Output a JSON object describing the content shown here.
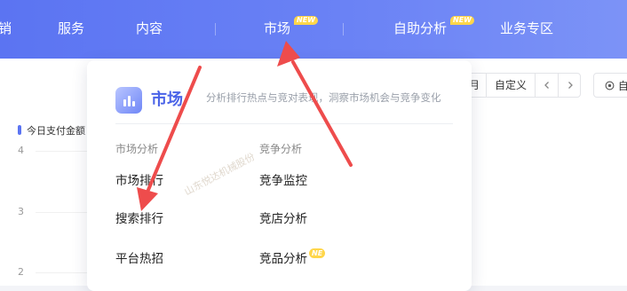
{
  "nav": {
    "items": [
      {
        "label": "销"
      },
      {
        "label": "服务"
      },
      {
        "label": "内容"
      },
      {
        "label": "市场",
        "badge": "NEW"
      },
      {
        "label": "自助分析",
        "badge": "NEW"
      },
      {
        "label": "业务专区"
      }
    ]
  },
  "dropdown": {
    "title": "市场",
    "description": "分析排行热点与竞对表现，洞察市场机会与竞争变化",
    "logo_icon": "chart-bars-icon",
    "groups": [
      {
        "heading": "市场分析",
        "links": [
          "市场排行",
          "搜索排行",
          "平台热招"
        ]
      },
      {
        "heading": "竞争分析",
        "links": [
          "竞争监控",
          "竞店分析",
          "竞品分析"
        ],
        "new_badge_text": "NE"
      }
    ],
    "watermark": "山东悦达机械股份"
  },
  "background": {
    "legend_label": "今日支付金额",
    "y_ticks": [
      "4",
      "3",
      "2"
    ],
    "date_controls": {
      "partial_label": "月",
      "custom_label": "自定义",
      "prev_icon": "chevron-left-icon",
      "next_icon": "chevron-right-icon"
    },
    "right_button": {
      "icon": "target-icon",
      "label": "自"
    }
  },
  "colors": {
    "nav_start": "#5b74f2",
    "nav_end": "#7c93f7",
    "accent": "#4a63e8",
    "badge": "#ffd64a",
    "arrow": "#ee4c4c"
  }
}
